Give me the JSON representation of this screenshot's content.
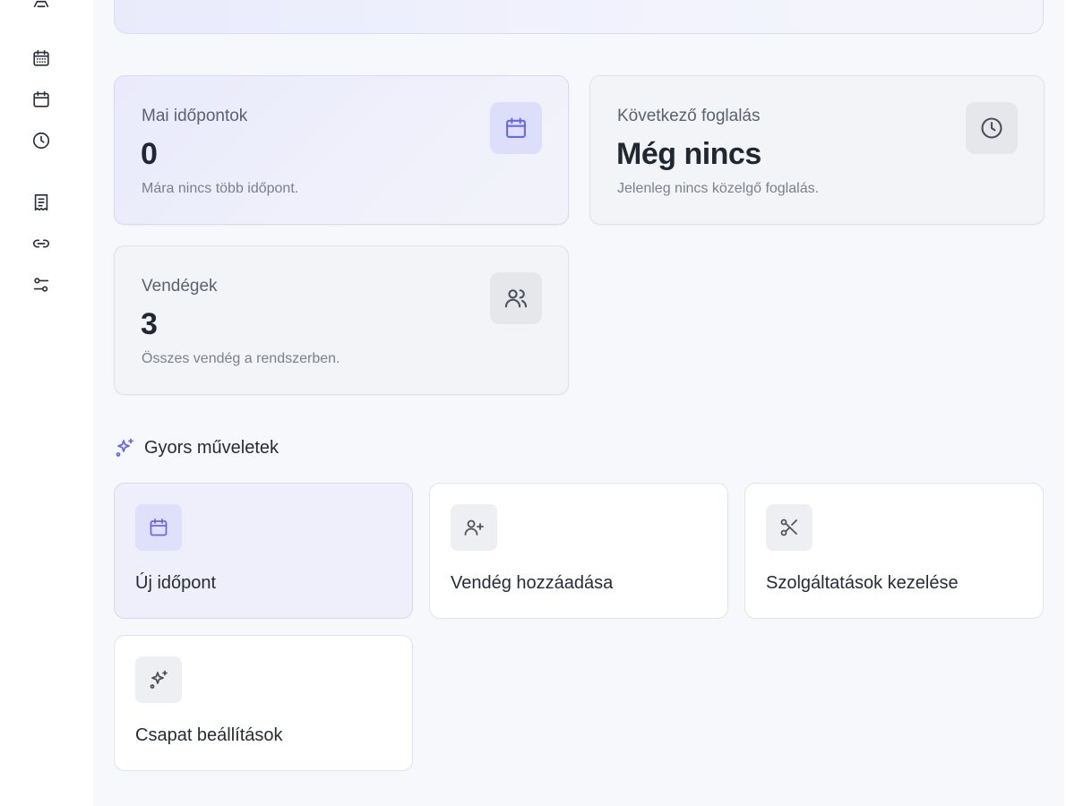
{
  "sidebar": {
    "icons": [
      {
        "name": "person-icon"
      },
      {
        "name": "calendar-grid-icon"
      },
      {
        "name": "calendar-icon"
      },
      {
        "name": "clock-icon"
      },
      {
        "name": "receipt-icon"
      },
      {
        "name": "link-icon"
      },
      {
        "name": "settings-sliders-icon"
      }
    ]
  },
  "stats": {
    "today": {
      "label": "Mai időpontok",
      "value": "0",
      "sub": "Mára nincs több időpont.",
      "icon": "calendar-icon"
    },
    "next": {
      "label": "Következő foglalás",
      "value": "Még nincs",
      "sub": "Jelenleg nincs közelgő foglalás.",
      "icon": "clock-icon"
    },
    "guests": {
      "label": "Vendégek",
      "value": "3",
      "sub": "Összes vendég a rendszerben.",
      "icon": "users-icon"
    }
  },
  "quick_actions": {
    "title": "Gyors műveletek",
    "items": [
      {
        "label": "Új időpont",
        "icon": "calendar-icon"
      },
      {
        "label": "Vendég hozzáadása",
        "icon": "user-plus-icon"
      },
      {
        "label": "Szolgáltatások kezelése",
        "icon": "scissors-icon"
      },
      {
        "label": "Csapat beállítások",
        "icon": "sparkles-icon"
      }
    ]
  },
  "colors": {
    "accent": "#6c67e6",
    "background": "#f7f8fb",
    "card": "#ffffff",
    "text": "#1f2733"
  }
}
